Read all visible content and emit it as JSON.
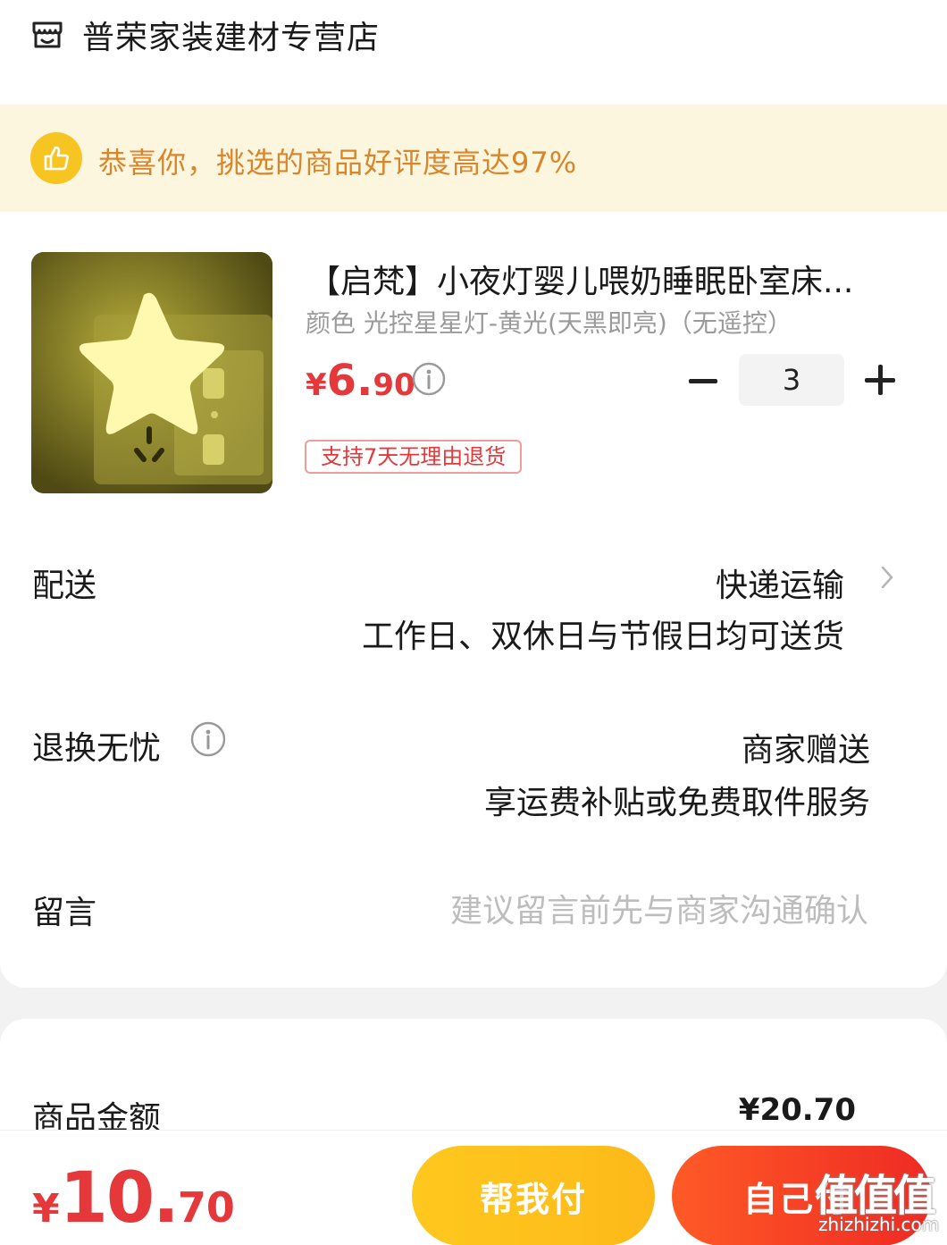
{
  "shop": {
    "icon": "shop-icon",
    "name": "普荣家装建材专营店"
  },
  "banner": {
    "icon": "thumbs-up-icon",
    "text": "恭喜你，挑选的商品好评度高达97%"
  },
  "product": {
    "image": "star-night-light-photo",
    "title": "【启梵】小夜灯婴儿喂奶睡眠卧室床...",
    "spec": "颜色 光控星星灯-黄光(天黑即亮)（无遥控）",
    "price_currency": "¥",
    "price_int": "6.",
    "price_dec": "90",
    "quantity": "3",
    "return_tag": "支持7天无理由退货"
  },
  "delivery": {
    "label": "配送",
    "method": "快递运输",
    "note": "工作日、双休日与节假日均可送货"
  },
  "returns": {
    "label": "退换无忧",
    "title": "商家赠送",
    "note": "享运费补贴或免费取件服务"
  },
  "message": {
    "label": "留言",
    "placeholder": "建议留言前先与商家沟通确认"
  },
  "summary": {
    "goods_amount_label": "商品金额",
    "goods_amount_value": "¥20.70"
  },
  "bottom_bar": {
    "pay_currency": "¥",
    "pay_int": "10.",
    "pay_dec": "70",
    "help_pay_label": "帮我付",
    "self_pay_label": "自己付"
  },
  "watermark": {
    "glyphs": "值值值",
    "url": "zhizhizhi.com"
  },
  "colors": {
    "accent_red": "#e4383a",
    "banner_bg": "#fdf6df",
    "banner_text": "#d8862c",
    "help_button": "#fdb91a",
    "self_button": "#ee2a24"
  }
}
